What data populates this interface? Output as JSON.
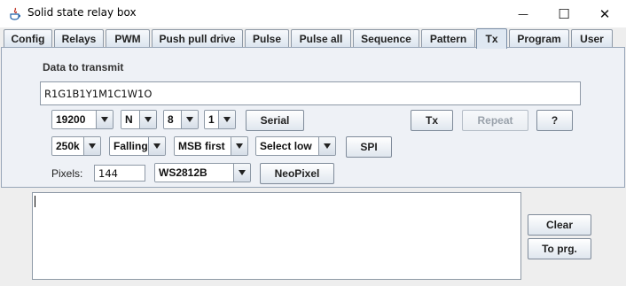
{
  "window": {
    "title": "Solid state relay box",
    "controls": {
      "minimize": "—",
      "maximize": "☐",
      "close": "✕"
    }
  },
  "tabs": [
    {
      "label": "Config",
      "active": false
    },
    {
      "label": "Relays",
      "active": false
    },
    {
      "label": "PWM",
      "active": false
    },
    {
      "label": "Push pull drive",
      "active": false
    },
    {
      "label": "Pulse",
      "active": false
    },
    {
      "label": "Pulse all",
      "active": false
    },
    {
      "label": "Sequence",
      "active": false
    },
    {
      "label": "Pattern",
      "active": false
    },
    {
      "label": "Tx",
      "active": true
    },
    {
      "label": "Program",
      "active": false
    },
    {
      "label": "User",
      "active": false
    }
  ],
  "tx": {
    "data_label": "Data to transmit",
    "data_value": "R1G1B1Y1M1C1W1O",
    "serial": {
      "baud": "19200",
      "parity": "N",
      "data_bits": "8",
      "stop_bits": "1",
      "button": "Serial"
    },
    "actions": {
      "tx": "Tx",
      "repeat": "Repeat",
      "help": "?"
    },
    "spi": {
      "speed": "250k",
      "edge": "Falling",
      "bit_order": "MSB first",
      "select": "Select low",
      "button": "SPI"
    },
    "neopixel": {
      "pixels_label": "Pixels:",
      "pixels_value": "144",
      "chip": "WS2812B",
      "button": "NeoPixel"
    }
  },
  "output": {
    "text": "",
    "clear": "Clear",
    "to_program": "To prg."
  }
}
